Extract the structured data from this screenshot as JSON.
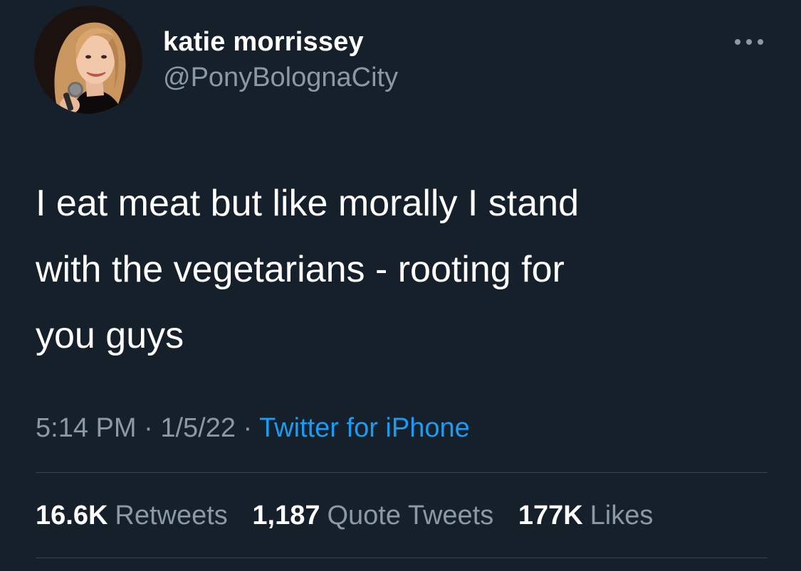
{
  "author": {
    "display_name": "katie morrissey",
    "handle": "@PonyBolognaCity",
    "avatar_icon": "profile-photo"
  },
  "tweet": {
    "text": "I eat meat but like morally I stand\nwith the vegetarians - rooting for\nyou guys"
  },
  "meta": {
    "time": "5:14 PM",
    "separator": "·",
    "date": "1/5/22",
    "source": "Twitter for iPhone"
  },
  "stats": {
    "retweets_count": "16.6K",
    "retweets_label": "Retweets",
    "quotes_count": "1,187",
    "quotes_label": "Quote Tweets",
    "likes_count": "177K",
    "likes_label": "Likes"
  },
  "icons": {
    "more": "more-horizontal-icon"
  },
  "colors": {
    "background": "#15202b",
    "primary_text": "#ffffff",
    "secondary_text": "#8b98a5",
    "link": "#1d9bf0",
    "divider": "#38444d"
  }
}
